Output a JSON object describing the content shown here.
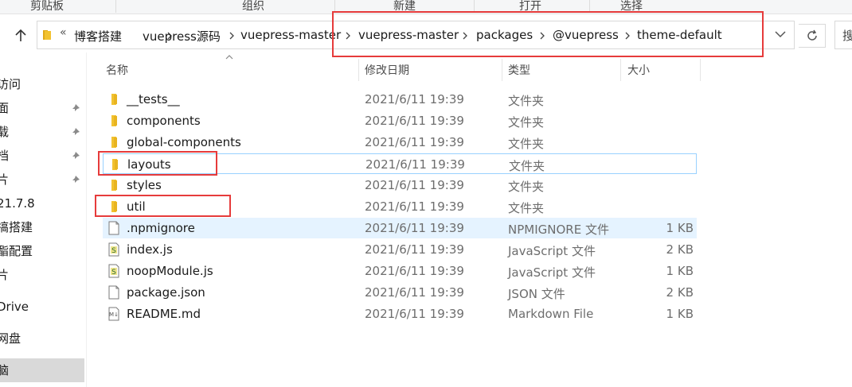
{
  "ribbon": {
    "groups": [
      "剪贴板",
      "组织",
      "新建",
      "打开",
      "选择"
    ]
  },
  "address": {
    "overflow_glyph": "«",
    "crumbs": [
      "博客搭建",
      "vuepress源码",
      "vuepress-master",
      "vuepress-master",
      "packages",
      "@vuepress",
      "theme-default"
    ]
  },
  "search": {
    "stub_text": "搜"
  },
  "nav": {
    "items": [
      {
        "label": "访问",
        "pinned": false
      },
      {
        "label": "面",
        "pinned": true
      },
      {
        "label": "载",
        "pinned": true
      },
      {
        "label": "档",
        "pinned": true
      },
      {
        "label": "片",
        "pinned": true
      },
      {
        "label": "21.7.8",
        "pinned": false
      },
      {
        "label": "搞搭建",
        "pinned": false
      },
      {
        "label": "酯配置",
        "pinned": false
      },
      {
        "label": "片",
        "pinned": false
      },
      {
        "label": "Drive",
        "pinned": false
      },
      {
        "label": "网盘",
        "pinned": false
      },
      {
        "label": "脑",
        "pinned": false,
        "selected": true
      }
    ]
  },
  "columns": {
    "name": "名称",
    "date": "修改日期",
    "type": "类型",
    "size": "大小"
  },
  "files": [
    {
      "name": "__tests__",
      "date": "2021/6/11 19:39",
      "type": "文件夹",
      "size": "",
      "icon": "folder-icon"
    },
    {
      "name": "components",
      "date": "2021/6/11 19:39",
      "type": "文件夹",
      "size": "",
      "icon": "folder-icon"
    },
    {
      "name": "global-components",
      "date": "2021/6/11 19:39",
      "type": "文件夹",
      "size": "",
      "icon": "folder-icon"
    },
    {
      "name": "layouts",
      "date": "2021/6/11 19:39",
      "type": "文件夹",
      "size": "",
      "icon": "folder-icon"
    },
    {
      "name": "styles",
      "date": "2021/6/11 19:39",
      "type": "文件夹",
      "size": "",
      "icon": "folder-icon"
    },
    {
      "name": "util",
      "date": "2021/6/11 19:39",
      "type": "文件夹",
      "size": "",
      "icon": "folder-icon"
    },
    {
      "name": ".npmignore",
      "date": "2021/6/11 19:39",
      "type": "NPMIGNORE 文件",
      "size": "1 KB",
      "icon": "file-icon"
    },
    {
      "name": "index.js",
      "date": "2021/6/11 19:39",
      "type": "JavaScript 文件",
      "size": "2 KB",
      "icon": "js-file-icon"
    },
    {
      "name": "noopModule.js",
      "date": "2021/6/11 19:39",
      "type": "JavaScript 文件",
      "size": "1 KB",
      "icon": "js-file-icon"
    },
    {
      "name": "package.json",
      "date": "2021/6/11 19:39",
      "type": "JSON 文件",
      "size": "2 KB",
      "icon": "file-icon"
    },
    {
      "name": "README.md",
      "date": "2021/6/11 19:39",
      "type": "Markdown File",
      "size": "1 KB",
      "icon": "markdown-file-icon"
    }
  ],
  "colors": {
    "folder": "#f2c230",
    "hover_row": "#e5f3ff",
    "focus_border": "#99d1ff",
    "annotation_red": "#e63b3b",
    "selected_nav": "#d9d9d9"
  }
}
